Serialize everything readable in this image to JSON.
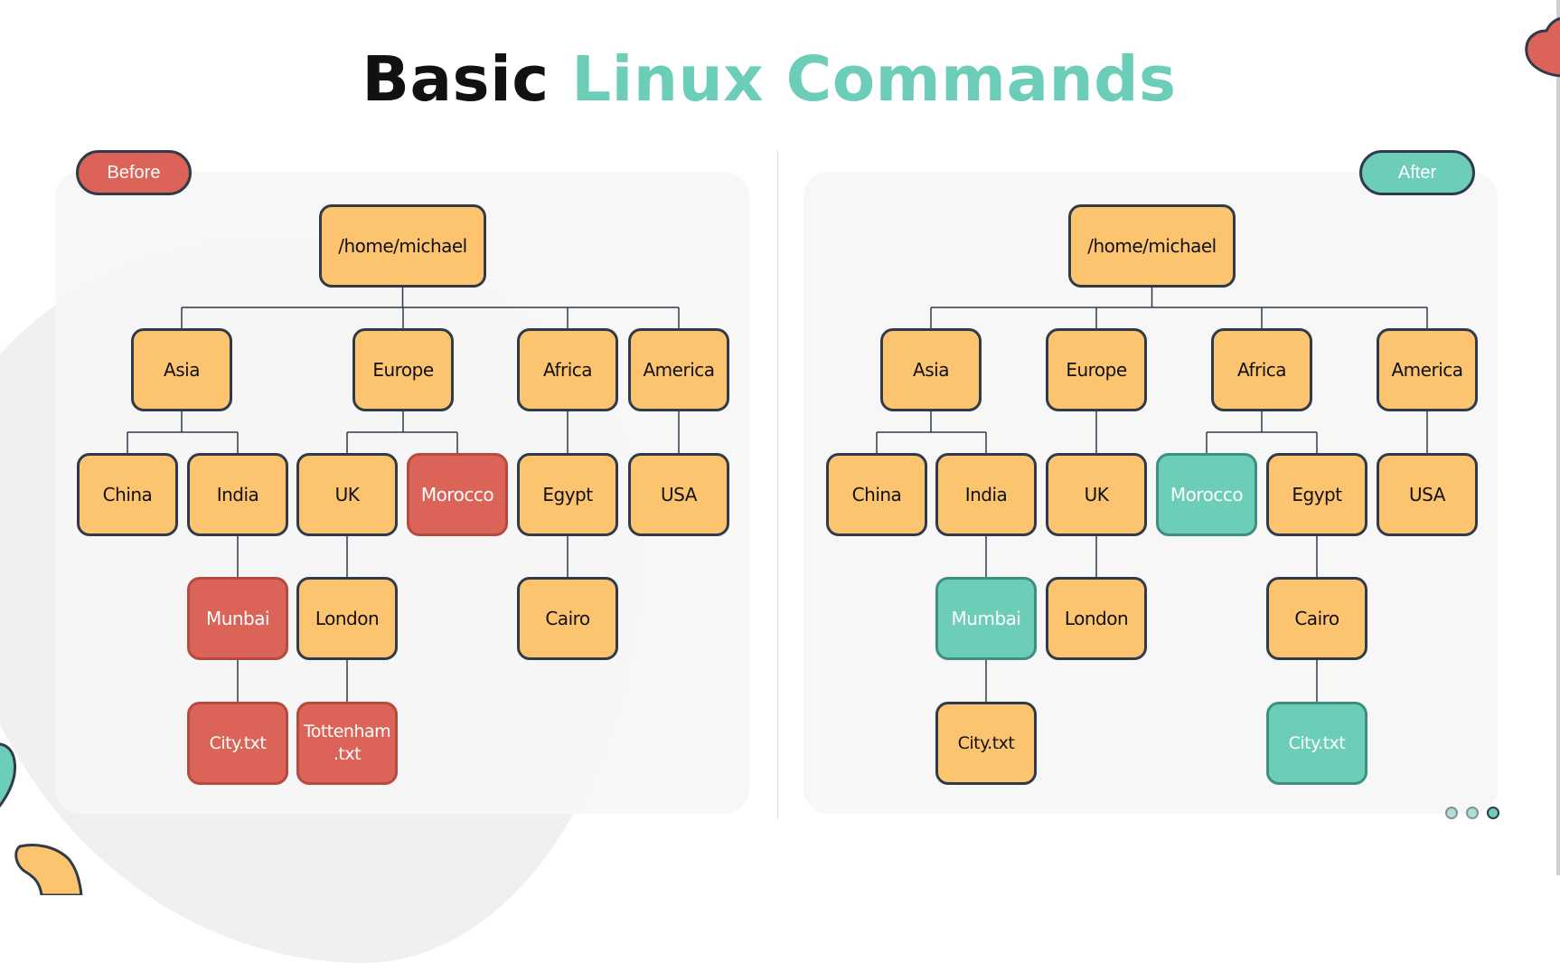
{
  "title": {
    "part1": "Basic",
    "part2": "Linux Commands"
  },
  "colors": {
    "accent_teal": "#6ccdb9",
    "accent_red": "#dc6357",
    "folder_orange": "#fdc470",
    "outline": "#2f3a4a"
  },
  "before": {
    "label": "Before",
    "tree": {
      "root": "/home/michael",
      "nodes": [
        {
          "id": "asia",
          "label": "Asia",
          "parent": "root",
          "color": "orange"
        },
        {
          "id": "europe",
          "label": "Europe",
          "parent": "root",
          "color": "orange"
        },
        {
          "id": "africa",
          "label": "Africa",
          "parent": "root",
          "color": "orange"
        },
        {
          "id": "america",
          "label": "America",
          "parent": "root",
          "color": "orange"
        },
        {
          "id": "china",
          "label": "China",
          "parent": "asia",
          "color": "orange"
        },
        {
          "id": "india",
          "label": "India",
          "parent": "asia",
          "color": "orange"
        },
        {
          "id": "uk",
          "label": "UK",
          "parent": "europe",
          "color": "orange"
        },
        {
          "id": "morocco",
          "label": "Morocco",
          "parent": "europe",
          "color": "red"
        },
        {
          "id": "egypt",
          "label": "Egypt",
          "parent": "africa",
          "color": "orange"
        },
        {
          "id": "usa",
          "label": "USA",
          "parent": "america",
          "color": "orange"
        },
        {
          "id": "munbai",
          "label": "Munbai",
          "parent": "india",
          "color": "red"
        },
        {
          "id": "london",
          "label": "London",
          "parent": "uk",
          "color": "orange"
        },
        {
          "id": "cairo",
          "label": "Cairo",
          "parent": "egypt",
          "color": "orange"
        },
        {
          "id": "city",
          "label": "City.txt",
          "parent": "munbai",
          "color": "red"
        },
        {
          "id": "tottenham",
          "label": "Tottenham .txt",
          "parent": "london",
          "color": "red"
        }
      ]
    }
  },
  "after": {
    "label": "After",
    "tree": {
      "root": "/home/michael",
      "nodes": [
        {
          "id": "asia",
          "label": "Asia",
          "parent": "root",
          "color": "orange"
        },
        {
          "id": "europe",
          "label": "Europe",
          "parent": "root",
          "color": "orange"
        },
        {
          "id": "africa",
          "label": "Africa",
          "parent": "root",
          "color": "orange"
        },
        {
          "id": "america",
          "label": "America",
          "parent": "root",
          "color": "orange"
        },
        {
          "id": "china",
          "label": "China",
          "parent": "asia",
          "color": "orange"
        },
        {
          "id": "india",
          "label": "India",
          "parent": "asia",
          "color": "orange"
        },
        {
          "id": "uk",
          "label": "UK",
          "parent": "europe",
          "color": "orange"
        },
        {
          "id": "morocco",
          "label": "Morocco",
          "parent": "africa",
          "color": "teal"
        },
        {
          "id": "egypt",
          "label": "Egypt",
          "parent": "africa",
          "color": "orange"
        },
        {
          "id": "usa",
          "label": "USA",
          "parent": "america",
          "color": "orange"
        },
        {
          "id": "mumbai",
          "label": "Mumbai",
          "parent": "india",
          "color": "teal"
        },
        {
          "id": "london",
          "label": "London",
          "parent": "uk",
          "color": "orange"
        },
        {
          "id": "cairo",
          "label": "Cairo",
          "parent": "egypt",
          "color": "orange"
        },
        {
          "id": "city1",
          "label": "City.txt",
          "parent": "mumbai",
          "color": "orange"
        },
        {
          "id": "city2",
          "label": "City.txt",
          "parent": "cairo",
          "color": "teal"
        }
      ]
    }
  },
  "pagination": {
    "total": 3,
    "current": 3
  }
}
